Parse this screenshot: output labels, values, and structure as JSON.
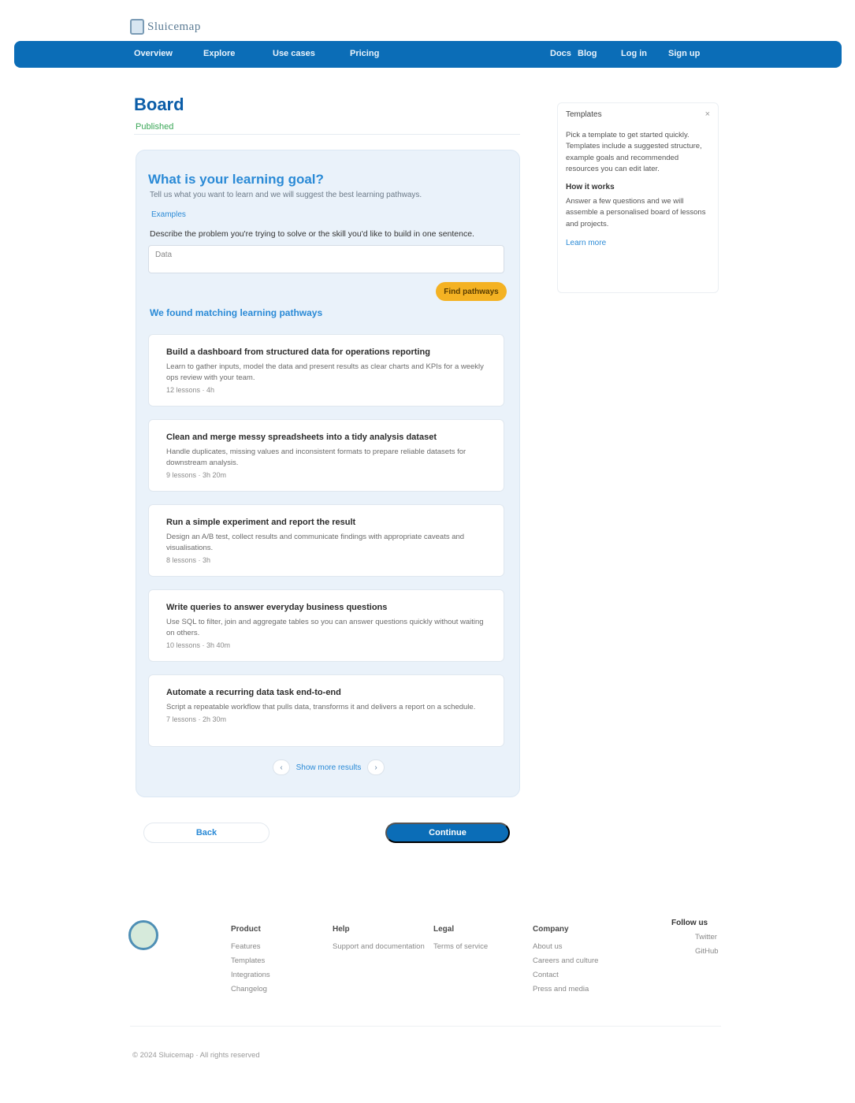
{
  "header": {
    "logo_text": "Sluicemap",
    "nav": [
      {
        "label": "Overview"
      },
      {
        "label": "Explore"
      },
      {
        "label": "Use cases"
      },
      {
        "label": "Pricing"
      },
      {
        "label": "Docs"
      },
      {
        "label": "Blog"
      },
      {
        "label": "Log in"
      },
      {
        "label": "Sign up"
      }
    ]
  },
  "page": {
    "title": "Board",
    "status": "Published",
    "question": {
      "heading": "What is your learning goal?",
      "subtitle": "Tell us what you want to learn and we will suggest the best learning pathways.",
      "example_link": "Examples",
      "prompt": "Describe the problem you're trying to solve or the skill you'd like to build in one sentence.",
      "input_value": "Data",
      "submit_label": "Find pathways"
    },
    "results_heading": "We found matching learning pathways",
    "results": [
      {
        "title": "Build a dashboard from structured data for operations reporting",
        "desc": "Learn to gather inputs, model the data and present results as clear charts and KPIs for a weekly ops review with your team.",
        "meta": "12 lessons · 4h"
      },
      {
        "title": "Clean and merge messy spreadsheets into a tidy analysis dataset",
        "desc": "Handle duplicates, missing values and inconsistent formats to prepare reliable datasets for downstream analysis.",
        "meta": "9 lessons · 3h 20m"
      },
      {
        "title": "Run a simple experiment and report the result",
        "desc": "Design an A/B test, collect results and communicate findings with appropriate caveats and visualisations.",
        "meta": "8 lessons · 3h"
      },
      {
        "title": "Write queries to answer everyday business questions",
        "desc": "Use SQL to filter, join and aggregate tables so you can answer questions quickly without waiting on others.",
        "meta": "10 lessons · 3h 40m"
      },
      {
        "title": "Automate a recurring data task end-to-end",
        "desc": "Script a repeatable workflow that pulls data, transforms it and delivers a report on a schedule.",
        "meta": "7 lessons · 2h 30m"
      }
    ],
    "pager": {
      "prev": "‹",
      "label": "Show more results",
      "next": "›"
    },
    "back_label": "Back",
    "next_label": "Continue"
  },
  "sidebar": {
    "title": "Templates",
    "close_icon": "close-icon",
    "text": "Pick a template to get started quickly. Templates include a suggested structure, example goals and recommended resources you can edit later.",
    "subheading": "How it works",
    "body": "Answer a few questions and we will assemble a personalised board of lessons and projects.",
    "link": "Learn more"
  },
  "footer": {
    "columns": [
      {
        "heading": "Product",
        "items": [
          "Features",
          "Templates",
          "Integrations",
          "Changelog"
        ]
      },
      {
        "heading": "Help",
        "items": [
          "Support and documentation"
        ]
      },
      {
        "heading": "Legal",
        "items": [
          "Terms of service"
        ]
      },
      {
        "heading": "Company",
        "items": [
          "About us",
          "Careers and culture",
          "Contact",
          "Press and media"
        ]
      }
    ],
    "social": "Follow us",
    "social_items": [
      "Twitter",
      "GitHub"
    ],
    "copyright": "© 2024 Sluicemap · All rights reserved"
  }
}
